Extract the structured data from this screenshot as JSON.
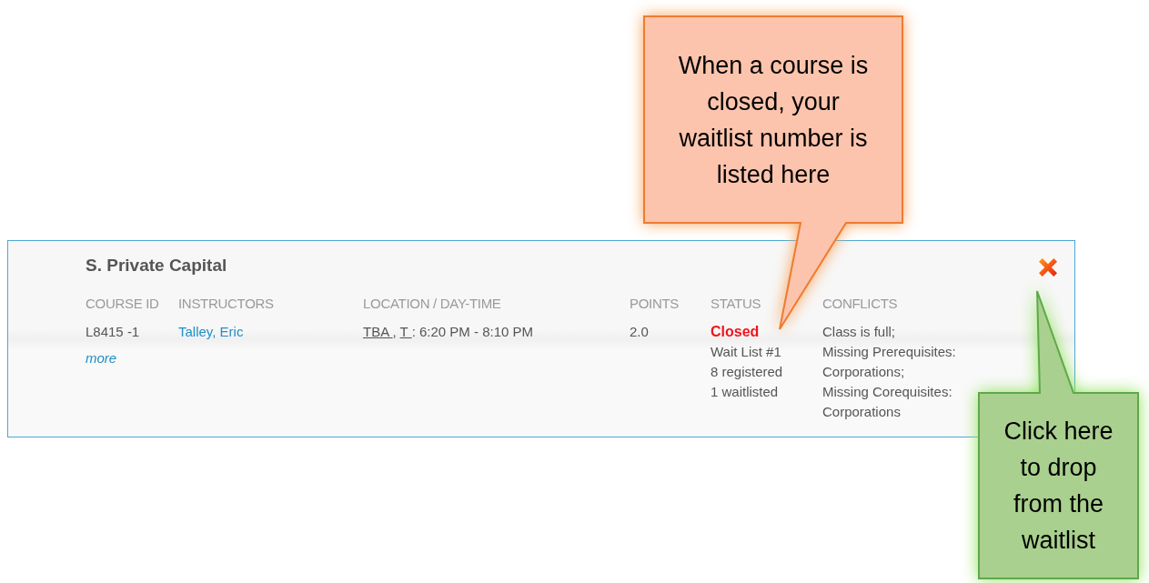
{
  "course": {
    "title": "S. Private Capital",
    "columns": [
      "COURSE ID",
      "INSTRUCTORS",
      "LOCATION / DAY-TIME",
      "POINTS",
      "STATUS",
      "CONFLICTS"
    ],
    "course_id": "L8415 -1",
    "more_link": "more",
    "instructor": "Talley, Eric",
    "location_parts": [
      {
        "text": "TBA ",
        "kind": "link"
      },
      {
        "text": ", ",
        "kind": "plain"
      },
      {
        "text": "T ",
        "kind": "link"
      },
      {
        "text": ": 6:20 PM - 8:10 PM",
        "kind": "plain"
      }
    ],
    "points": "2.0",
    "status": {
      "label": "Closed",
      "kind": "closed",
      "details": [
        "Wait List #1",
        "8 registered",
        "1 waitlisted"
      ]
    },
    "conflicts": [
      "Class is full;",
      "Missing Prerequisites:",
      "Corporations;",
      "Missing Corequisites:",
      "Corporations"
    ]
  },
  "callouts": [
    {
      "text": "When a course is closed, your waitlist number is listed here",
      "kind": "orange"
    },
    {
      "text": "Click here to drop from the waitlist",
      "kind": "green"
    }
  ]
}
